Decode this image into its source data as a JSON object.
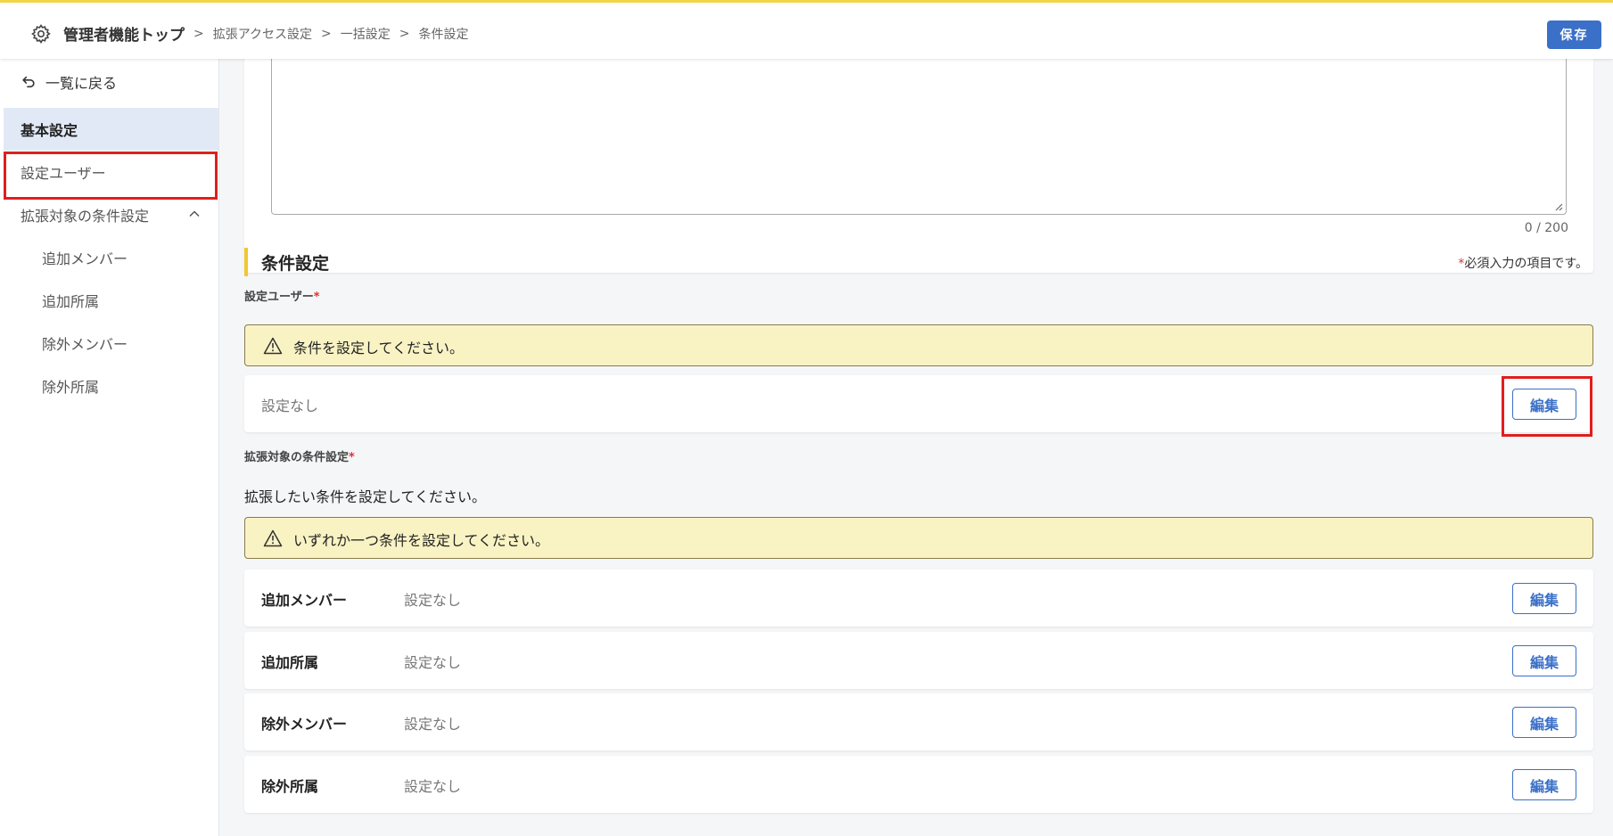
{
  "header": {
    "breadcrumb_root": "管理者機能トップ",
    "breadcrumbs": [
      "拡張アクセス設定",
      "一括設定",
      "条件設定"
    ],
    "save_label": "保存"
  },
  "sidebar": {
    "back_label": "一覧に戻る",
    "items": [
      {
        "label": "基本設定"
      },
      {
        "label": "設定ユーザー"
      },
      {
        "label": "拡張対象の条件設定"
      },
      {
        "label": "追加メンバー"
      },
      {
        "label": "追加所属"
      },
      {
        "label": "除外メンバー"
      },
      {
        "label": "除外所属"
      }
    ]
  },
  "main": {
    "char_counter": "0 / 200",
    "section_title": "条件設定",
    "required_note_star": "*",
    "required_note": "必須入力の項目です。",
    "setting_user": {
      "label": "設定ユーザー",
      "star": "*",
      "warning": "条件を設定してください。",
      "value": "設定なし",
      "edit_label": "編集"
    },
    "extension": {
      "label": "拡張対象の条件設定",
      "star": "*",
      "description": "拡張したい条件を設定してください。",
      "warning": "いずれか一つ条件を設定してください。",
      "rows": [
        {
          "name": "追加メンバー",
          "value": "設定なし",
          "edit_label": "編集"
        },
        {
          "name": "追加所属",
          "value": "設定なし",
          "edit_label": "編集"
        },
        {
          "name": "除外メンバー",
          "value": "設定なし",
          "edit_label": "編集"
        },
        {
          "name": "除外所属",
          "value": "設定なし",
          "edit_label": "編集"
        }
      ]
    }
  },
  "icons": {
    "gear": "gear-icon",
    "back": "undo-arrow-icon",
    "chevron": "chevron-up-icon",
    "warning": "warning-triangle-icon"
  },
  "colors": {
    "accent": "#3b70c8",
    "top_border": "#f2d544",
    "section_bar": "#f2c830",
    "warning_bg": "#f9f3c4",
    "highlight": "#e01e1e",
    "active_nav_bg": "#e2e9f6"
  }
}
